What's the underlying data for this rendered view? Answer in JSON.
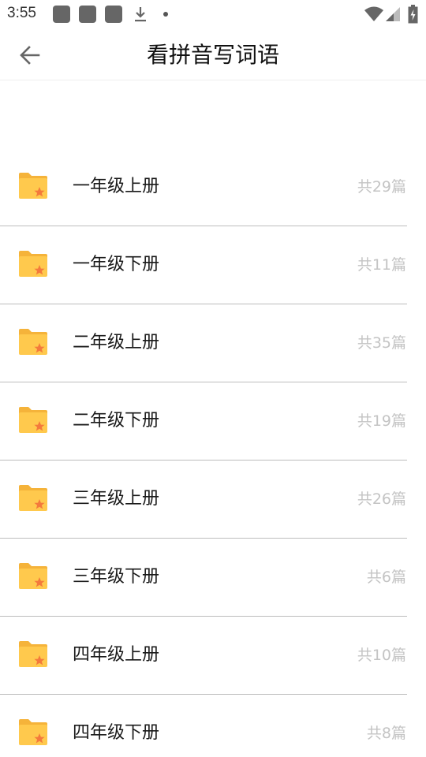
{
  "status_bar": {
    "time": "3:55"
  },
  "header": {
    "title": "看拼音写词语",
    "back_icon": "arrow-left-icon"
  },
  "list": {
    "items": [
      {
        "label": "一年级上册",
        "count": "共29篇"
      },
      {
        "label": "一年级下册",
        "count": "共11篇"
      },
      {
        "label": "二年级上册",
        "count": "共35篇"
      },
      {
        "label": "二年级下册",
        "count": "共19篇"
      },
      {
        "label": "三年级上册",
        "count": "共26篇"
      },
      {
        "label": "三年级下册",
        "count": "共6篇"
      },
      {
        "label": "四年级上册",
        "count": "共10篇"
      },
      {
        "label": "四年级下册",
        "count": "共8篇"
      }
    ]
  },
  "colors": {
    "folder": "#FFC94D",
    "folder_tab": "#F5B33A",
    "star": "#F47A3C",
    "count_text": "#C4C4C4",
    "divider": "#BDBDBD"
  }
}
